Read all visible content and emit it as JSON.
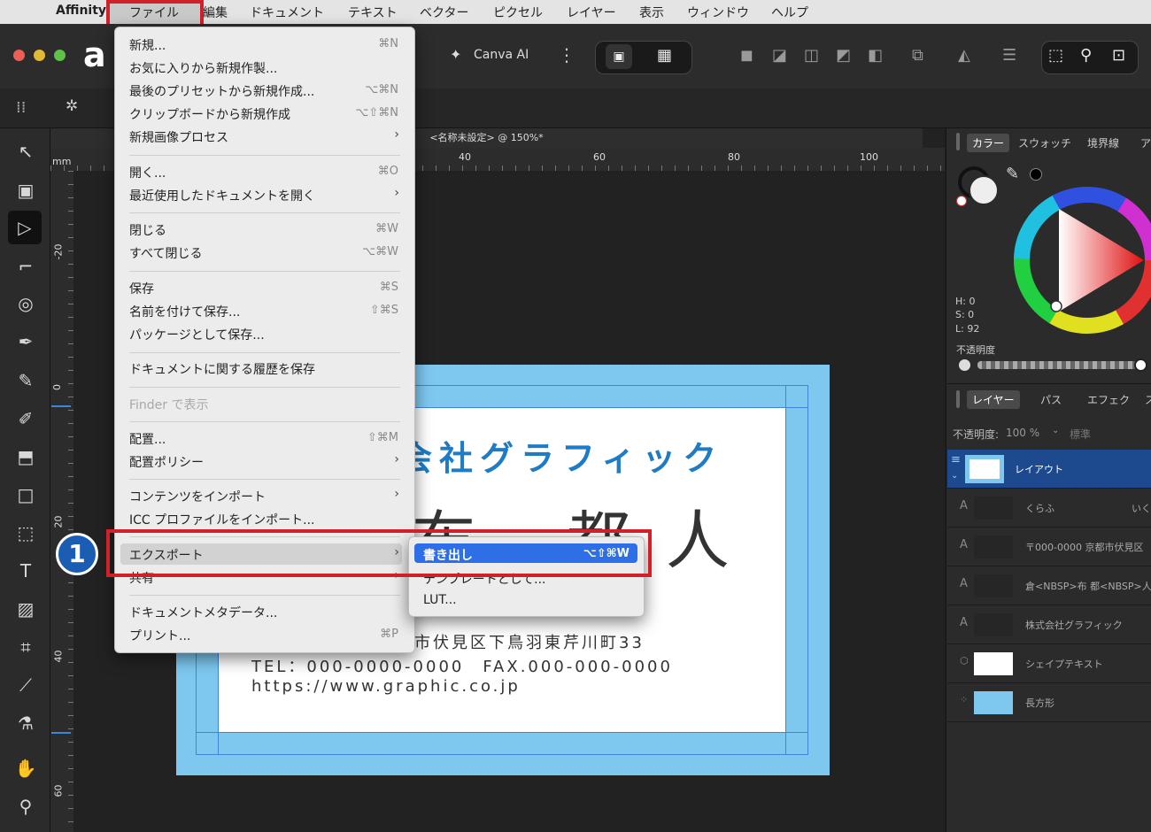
{
  "menubar": {
    "apple": "",
    "app": "Affinity",
    "items": [
      "ファイル",
      "編集",
      "ドキュメント",
      "テキスト",
      "ベクター",
      "ピクセル",
      "レイヤー",
      "表示",
      "ウィンドウ",
      "ヘルプ"
    ]
  },
  "toolbar": {
    "canva_ai": "Canva AI"
  },
  "document": {
    "tab_title": "<名称未設定> @ 150%*",
    "ruler_unit": "mm",
    "hruler_ticks": [
      "40",
      "60",
      "80",
      "100"
    ],
    "vruler_ticks": [
      "-20",
      "0",
      "20",
      "40",
      "60"
    ]
  },
  "card": {
    "company": "会社グラフィック",
    "person": "布 都人",
    "address": "市伏見区下鳥羽東芹川町33",
    "telfax": "TEL：000-0000-0000　FAX.000-000-0000",
    "url": "https://www.graphic.co.jp"
  },
  "color_panel": {
    "tabs": [
      "カラー",
      "スウォッチ",
      "境界線",
      "ア"
    ],
    "h": "H: 0",
    "s": "S: 0",
    "l": "L: 92",
    "opacity_label": "不透明度"
  },
  "layers_panel": {
    "tabs": [
      "レイヤー",
      "パス",
      "エフェク",
      "ス"
    ],
    "opacity_label": "不透明度:",
    "opacity_value": "100 %",
    "blend_mode": "標準",
    "rows": [
      {
        "name": "レイアウト"
      },
      {
        "name": "くらふ",
        "extra": "いく"
      },
      {
        "name": "〒000-0000 京都市伏見区"
      },
      {
        "name": "倉<NBSP>布 都<NBSP>人"
      },
      {
        "name": "株式会社グラフィック"
      },
      {
        "name": "シェイプテキスト"
      },
      {
        "name": "長方形"
      }
    ]
  },
  "file_menu": {
    "items": [
      {
        "label": "新規...",
        "shortcut": "⌘N"
      },
      {
        "label": "お気に入りから新規作製...",
        "shortcut": ""
      },
      {
        "label": "最後のプリセットから新規作成...",
        "shortcut": "⌥⌘N"
      },
      {
        "label": "クリップボードから新規作成",
        "shortcut": "⌥⇧⌘N"
      },
      {
        "label": "新規画像プロセス",
        "shortcut": "›"
      },
      {
        "label": "開く...",
        "shortcut": "⌘O"
      },
      {
        "label": "最近使用したドキュメントを開く",
        "shortcut": "›"
      },
      {
        "label": "閉じる",
        "shortcut": "⌘W"
      },
      {
        "label": "すべて閉じる",
        "shortcut": "⌥⌘W"
      },
      {
        "label": "保存",
        "shortcut": "⌘S"
      },
      {
        "label": "名前を付けて保存...",
        "shortcut": "⇧⌘S"
      },
      {
        "label": "パッケージとして保存...",
        "shortcut": ""
      },
      {
        "label": "ドキュメントに関する履歴を保存",
        "shortcut": ""
      },
      {
        "label": "Finder で表示",
        "shortcut": ""
      },
      {
        "label": "配置...",
        "shortcut": "⇧⌘M"
      },
      {
        "label": "配置ポリシー",
        "shortcut": "›"
      },
      {
        "label": "コンテンツをインポート",
        "shortcut": "›"
      },
      {
        "label": "ICC プロファイルをインポート...",
        "shortcut": ""
      },
      {
        "label": "エクスポート",
        "shortcut": "›"
      },
      {
        "label": "共有",
        "shortcut": "›"
      },
      {
        "label": "ドキュメントメタデータ...",
        "shortcut": ""
      },
      {
        "label": "プリント...",
        "shortcut": "⌘P"
      }
    ]
  },
  "export_submenu": {
    "items": [
      {
        "label": "書き出し",
        "shortcut": "⌥⇧⌘W"
      },
      {
        "label": "テンプレートとして...",
        "shortcut": ""
      },
      {
        "label": "LUT...",
        "shortcut": ""
      }
    ]
  },
  "annotation": {
    "badge": "1"
  },
  "colors": {
    "accent": "#2e6ee6",
    "highlight_red": "#d0202a",
    "card_blue": "#7ec8f0",
    "company_blue": "#1f7cc4"
  }
}
